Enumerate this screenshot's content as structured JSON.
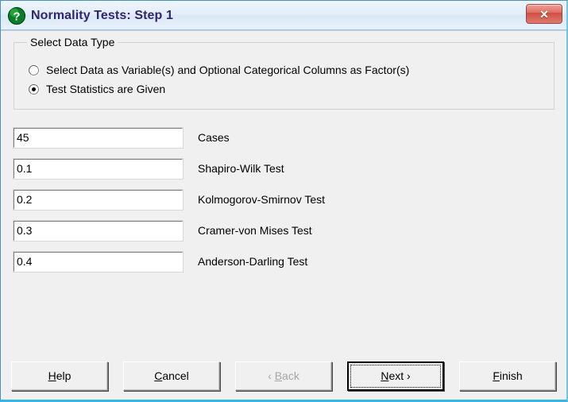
{
  "window": {
    "title": "Normality Tests: Step 1",
    "icon": "question-mark-icon",
    "close_label": "✕",
    "accent_titlebar": "#e4eef8",
    "accent_border": "#35b6e8",
    "title_color": "#31256b",
    "close_color": "#cf4f42"
  },
  "groupbox": {
    "label": "Select Data Type",
    "options": [
      {
        "label": "Select Data as Variable(s) and Optional Categorical Columns as Factor(s)",
        "selected": false
      },
      {
        "label": "Test Statistics are Given",
        "selected": true
      }
    ]
  },
  "fields": [
    {
      "value": "45",
      "label": "Cases"
    },
    {
      "value": "0.1",
      "label": "Shapiro-Wilk Test"
    },
    {
      "value": "0.2",
      "label": "Kolmogorov-Smirnov Test"
    },
    {
      "value": "0.3",
      "label": "Cramer-von Mises Test"
    },
    {
      "value": "0.4",
      "label": "Anderson-Darling Test"
    }
  ],
  "buttons": [
    {
      "mnemonic": "H",
      "rest": "elp",
      "state": "normal"
    },
    {
      "mnemonic": "C",
      "rest": "ancel",
      "state": "normal"
    },
    {
      "prefix": "‹ ",
      "mnemonic": "B",
      "rest": "ack",
      "state": "disabled"
    },
    {
      "mnemonic": "N",
      "rest": "ext ›",
      "state": "default"
    },
    {
      "mnemonic": "F",
      "rest": "inish",
      "state": "normal"
    }
  ]
}
